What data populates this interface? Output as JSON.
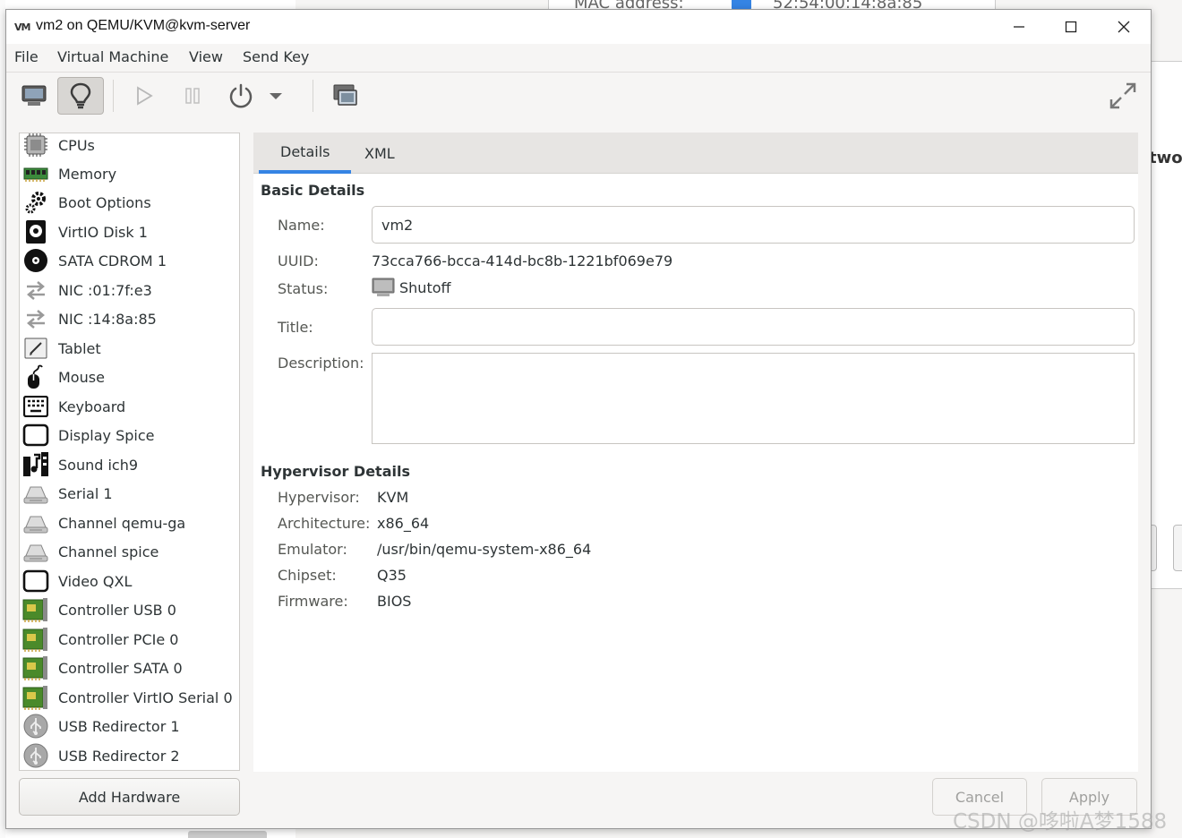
{
  "background": {
    "top_label": "MAC address:",
    "top_value": "52:54:00:14:8a:85",
    "side_text": "two"
  },
  "window": {
    "icon_text": "VM",
    "title": "vm2 on QEMU/KVM@kvm-server",
    "controls": [
      "minimize",
      "maximize",
      "close"
    ]
  },
  "menubar": {
    "items": [
      "File",
      "Virtual Machine",
      "View",
      "Send Key"
    ]
  },
  "toolbar": {
    "buttons": [
      "console-icon",
      "lightbulb-icon",
      "play-icon",
      "pause-icon",
      "power-icon",
      "dropdown-arrow-icon",
      "screenshot-icon",
      "fullscreen-icon"
    ],
    "active": "lightbulb-icon"
  },
  "devices": [
    {
      "label": "CPUs",
      "icon": "cpu-icon"
    },
    {
      "label": "Memory",
      "icon": "memory-icon"
    },
    {
      "label": "Boot Options",
      "icon": "gears-icon"
    },
    {
      "label": "VirtIO Disk 1",
      "icon": "disk-icon"
    },
    {
      "label": "SATA CDROM 1",
      "icon": "cdrom-icon"
    },
    {
      "label": "NIC :01:7f:e3",
      "icon": "nic-icon"
    },
    {
      "label": "NIC :14:8a:85",
      "icon": "nic-icon"
    },
    {
      "label": "Tablet",
      "icon": "tablet-icon"
    },
    {
      "label": "Mouse",
      "icon": "mouse-icon"
    },
    {
      "label": "Keyboard",
      "icon": "keyboard-icon"
    },
    {
      "label": "Display Spice",
      "icon": "display-icon"
    },
    {
      "label": "Sound ich9",
      "icon": "sound-icon"
    },
    {
      "label": "Serial 1",
      "icon": "serial-icon"
    },
    {
      "label": "Channel qemu-ga",
      "icon": "serial-icon"
    },
    {
      "label": "Channel spice",
      "icon": "serial-icon"
    },
    {
      "label": "Video QXL",
      "icon": "display-icon"
    },
    {
      "label": "Controller USB 0",
      "icon": "controller-icon"
    },
    {
      "label": "Controller PCIe 0",
      "icon": "controller-icon"
    },
    {
      "label": "Controller SATA 0",
      "icon": "controller-icon"
    },
    {
      "label": "Controller VirtIO Serial 0",
      "icon": "controller-icon"
    },
    {
      "label": "USB Redirector 1",
      "icon": "usb-icon"
    },
    {
      "label": "USB Redirector 2",
      "icon": "usb-icon"
    }
  ],
  "add_hardware_label": "Add Hardware",
  "tabs": [
    {
      "label": "Details",
      "active": true
    },
    {
      "label": "XML",
      "active": false
    }
  ],
  "basic": {
    "section_title": "Basic Details",
    "name_label": "Name:",
    "name_value": "vm2",
    "uuid_label": "UUID:",
    "uuid_value": "73cca766-bcca-414d-bc8b-1221bf069e79",
    "status_label": "Status:",
    "status_value": "Shutoff",
    "title_label": "Title:",
    "title_value": "",
    "description_label": "Description:",
    "description_value": ""
  },
  "hypervisor": {
    "section_title": "Hypervisor Details",
    "rows": [
      {
        "label": "Hypervisor:",
        "value": "KVM"
      },
      {
        "label": "Architecture:",
        "value": "x86_64"
      },
      {
        "label": "Emulator:",
        "value": "/usr/bin/qemu-system-x86_64"
      },
      {
        "label": "Chipset:",
        "value": "Q35"
      },
      {
        "label": "Firmware:",
        "value": "BIOS"
      }
    ]
  },
  "footer": {
    "cancel_label": "Cancel",
    "apply_label": "Apply"
  },
  "watermark": "CSDN @哆啦A梦1588",
  "colors": {
    "accent": "#3584e4",
    "window_bg": "#f6f5f4",
    "tab_bar": "#e7e5e3"
  }
}
